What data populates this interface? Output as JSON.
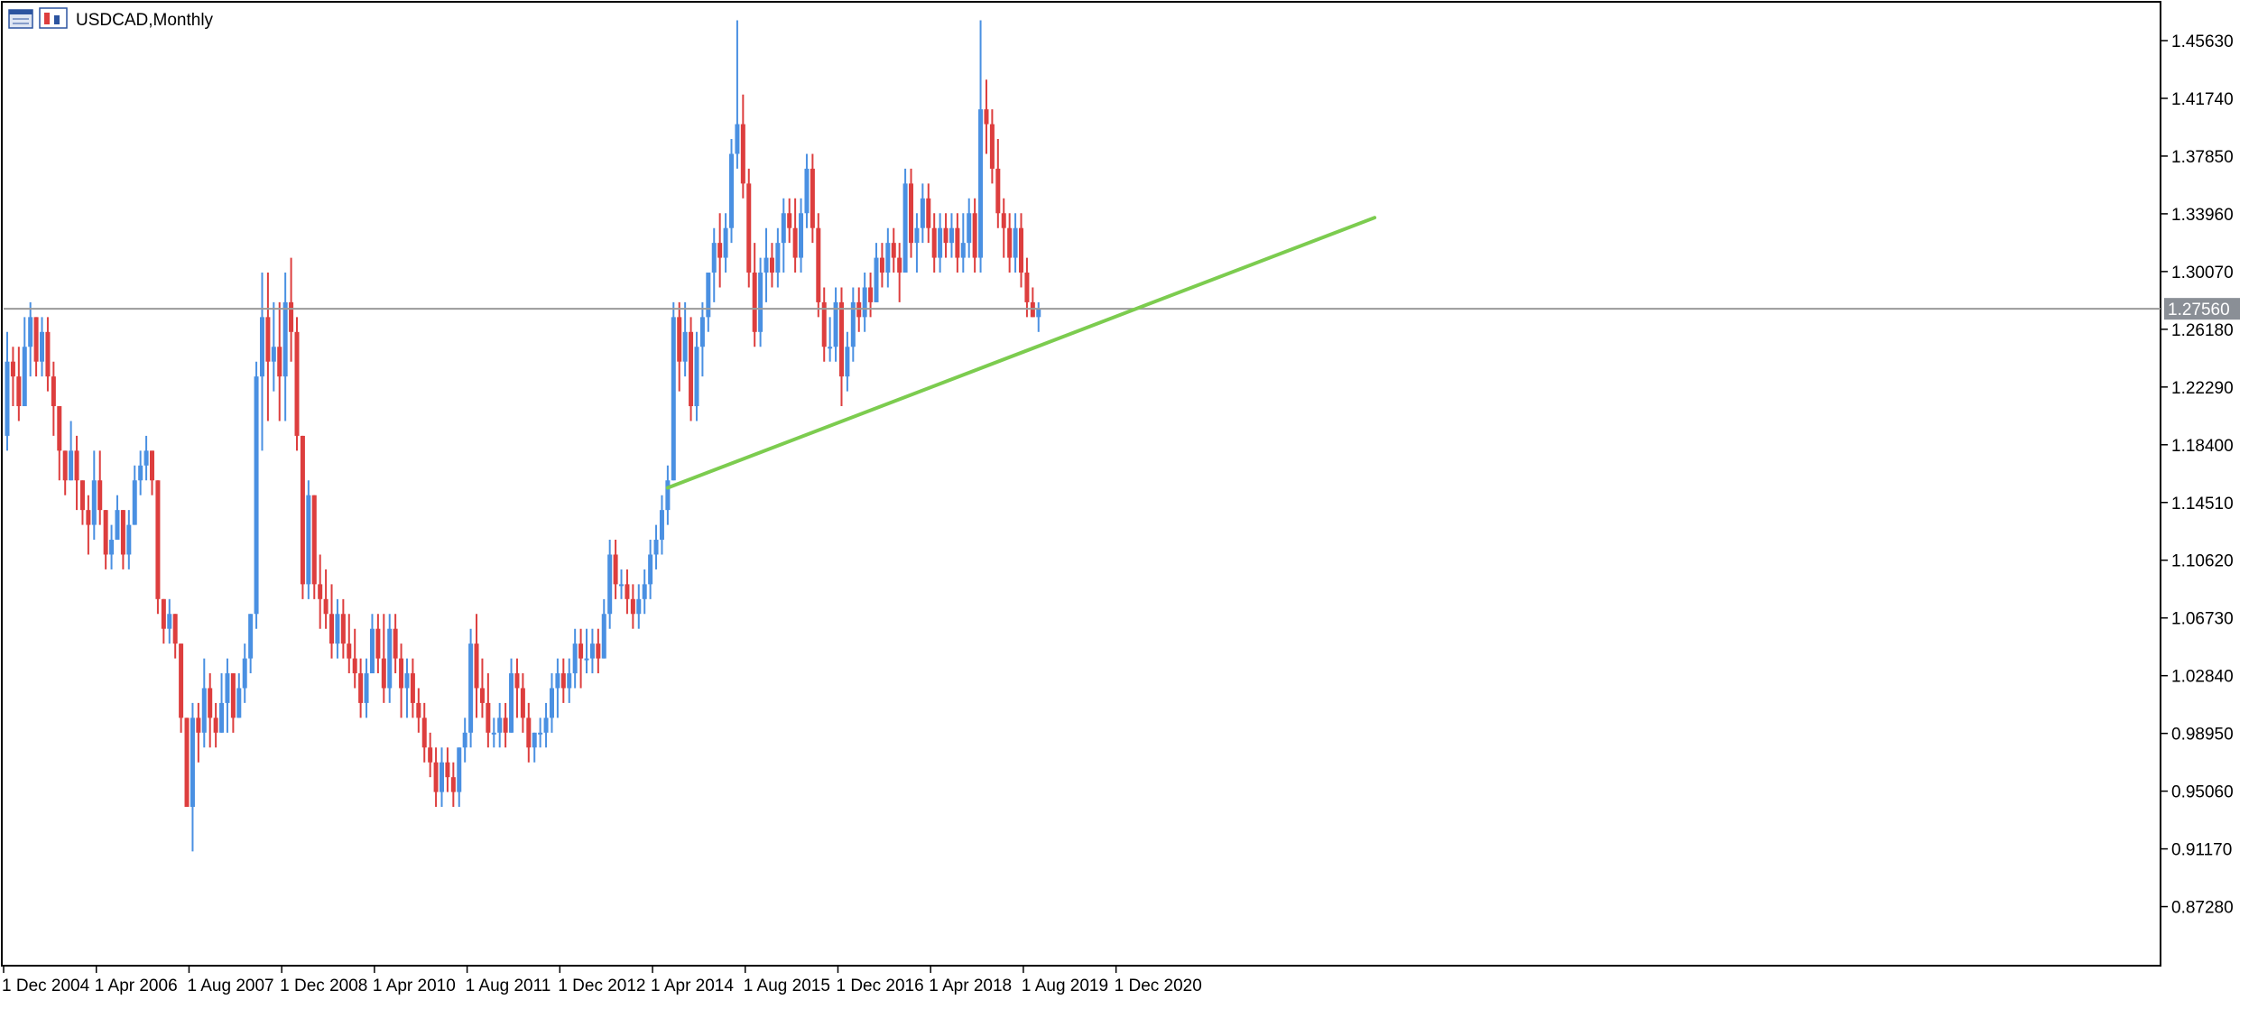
{
  "window": {
    "symbol_title": "USDCAD,Monthly",
    "icon": "chart-window-icon"
  },
  "colors": {
    "bull": "#4a90e2",
    "bear": "#dd3e3e",
    "trendline": "#7ccc4f",
    "price_line": "#9a9a9a",
    "price_tag_bg": "#8a8f96",
    "frame": "#000000"
  },
  "chart_data": {
    "type": "candlestick",
    "title": "USDCAD,Monthly",
    "xlabel": "",
    "ylabel": "",
    "ylim": [
      0.833,
      1.4715
    ],
    "y_ticks": [
      "1.45630",
      "1.41740",
      "1.37850",
      "1.33960",
      "1.30070",
      "1.26180",
      "1.22290",
      "1.18400",
      "1.14510",
      "1.10620",
      "1.06730",
      "1.02840",
      "0.98950",
      "0.95060",
      "0.91170",
      "0.87280"
    ],
    "x_tick_labels": [
      "1 Dec 2004",
      "1 Apr 2006",
      "1 Aug 2007",
      "1 Dec 2008",
      "1 Apr 2010",
      "1 Aug 2011",
      "1 Dec 2012",
      "1 Apr 2014",
      "1 Aug 2015",
      "1 Dec 2016",
      "1 Apr 2018",
      "1 Aug 2019",
      "1 Dec 2020"
    ],
    "x_tick_months": [
      0,
      16,
      32,
      48,
      64,
      80,
      96,
      112,
      128,
      144,
      160,
      176,
      192
    ],
    "current_price": "1.27560",
    "trendline": {
      "from": {
        "month": 114,
        "price": 1.155
      },
      "to": {
        "month": 236,
        "price": 1.337
      }
    },
    "grid": false,
    "ohlc": [
      [
        1.19,
        1.26,
        1.18,
        1.24
      ],
      [
        1.24,
        1.25,
        1.21,
        1.23
      ],
      [
        1.23,
        1.25,
        1.2,
        1.21
      ],
      [
        1.21,
        1.27,
        1.21,
        1.25
      ],
      [
        1.25,
        1.28,
        1.23,
        1.27
      ],
      [
        1.27,
        1.27,
        1.23,
        1.24
      ],
      [
        1.24,
        1.27,
        1.23,
        1.26
      ],
      [
        1.26,
        1.27,
        1.22,
        1.23
      ],
      [
        1.23,
        1.24,
        1.19,
        1.21
      ],
      [
        1.21,
        1.21,
        1.16,
        1.18
      ],
      [
        1.18,
        1.18,
        1.15,
        1.16
      ],
      [
        1.16,
        1.2,
        1.16,
        1.18
      ],
      [
        1.18,
        1.19,
        1.14,
        1.16
      ],
      [
        1.16,
        1.16,
        1.13,
        1.14
      ],
      [
        1.14,
        1.15,
        1.11,
        1.13
      ],
      [
        1.13,
        1.18,
        1.12,
        1.16
      ],
      [
        1.16,
        1.18,
        1.13,
        1.14
      ],
      [
        1.14,
        1.14,
        1.1,
        1.11
      ],
      [
        1.11,
        1.13,
        1.1,
        1.12
      ],
      [
        1.12,
        1.15,
        1.12,
        1.14
      ],
      [
        1.14,
        1.14,
        1.1,
        1.11
      ],
      [
        1.11,
        1.14,
        1.1,
        1.13
      ],
      [
        1.13,
        1.17,
        1.13,
        1.16
      ],
      [
        1.16,
        1.18,
        1.15,
        1.17
      ],
      [
        1.17,
        1.19,
        1.16,
        1.18
      ],
      [
        1.18,
        1.18,
        1.15,
        1.16
      ],
      [
        1.16,
        1.16,
        1.07,
        1.08
      ],
      [
        1.08,
        1.08,
        1.05,
        1.06
      ],
      [
        1.06,
        1.08,
        1.05,
        1.07
      ],
      [
        1.07,
        1.07,
        1.04,
        1.05
      ],
      [
        1.05,
        1.05,
        0.99,
        1.0
      ],
      [
        1.0,
        1.0,
        0.94,
        0.94
      ],
      [
        0.94,
        1.01,
        0.91,
        1.0
      ],
      [
        1.0,
        1.01,
        0.97,
        0.99
      ],
      [
        0.99,
        1.04,
        0.98,
        1.02
      ],
      [
        1.02,
        1.03,
        0.98,
        1.0
      ],
      [
        1.0,
        1.01,
        0.98,
        0.99
      ],
      [
        0.99,
        1.03,
        0.99,
        1.01
      ],
      [
        1.01,
        1.04,
        0.99,
        1.03
      ],
      [
        1.03,
        1.03,
        0.99,
        1.0
      ],
      [
        1.0,
        1.03,
        1.0,
        1.02
      ],
      [
        1.02,
        1.05,
        1.01,
        1.04
      ],
      [
        1.04,
        1.07,
        1.03,
        1.07
      ],
      [
        1.07,
        1.24,
        1.06,
        1.23
      ],
      [
        1.23,
        1.3,
        1.18,
        1.27
      ],
      [
        1.27,
        1.3,
        1.2,
        1.24
      ],
      [
        1.24,
        1.28,
        1.22,
        1.25
      ],
      [
        1.25,
        1.28,
        1.2,
        1.23
      ],
      [
        1.23,
        1.3,
        1.2,
        1.28
      ],
      [
        1.28,
        1.31,
        1.24,
        1.26
      ],
      [
        1.26,
        1.27,
        1.18,
        1.19
      ],
      [
        1.19,
        1.19,
        1.08,
        1.09
      ],
      [
        1.09,
        1.16,
        1.08,
        1.15
      ],
      [
        1.15,
        1.15,
        1.08,
        1.09
      ],
      [
        1.09,
        1.11,
        1.06,
        1.08
      ],
      [
        1.08,
        1.1,
        1.06,
        1.07
      ],
      [
        1.07,
        1.09,
        1.04,
        1.05
      ],
      [
        1.05,
        1.08,
        1.04,
        1.07
      ],
      [
        1.07,
        1.08,
        1.04,
        1.05
      ],
      [
        1.05,
        1.07,
        1.03,
        1.04
      ],
      [
        1.04,
        1.06,
        1.02,
        1.03
      ],
      [
        1.03,
        1.04,
        1.0,
        1.01
      ],
      [
        1.01,
        1.04,
        1.0,
        1.03
      ],
      [
        1.03,
        1.07,
        1.03,
        1.06
      ],
      [
        1.06,
        1.07,
        1.03,
        1.04
      ],
      [
        1.04,
        1.07,
        1.01,
        1.02
      ],
      [
        1.02,
        1.07,
        1.01,
        1.06
      ],
      [
        1.06,
        1.07,
        1.03,
        1.04
      ],
      [
        1.04,
        1.05,
        1.0,
        1.02
      ],
      [
        1.02,
        1.04,
        1.0,
        1.03
      ],
      [
        1.03,
        1.04,
        1.0,
        1.01
      ],
      [
        1.01,
        1.02,
        0.99,
        1.0
      ],
      [
        1.0,
        1.01,
        0.97,
        0.98
      ],
      [
        0.98,
        0.99,
        0.96,
        0.97
      ],
      [
        0.97,
        0.98,
        0.94,
        0.95
      ],
      [
        0.95,
        0.98,
        0.94,
        0.97
      ],
      [
        0.97,
        0.98,
        0.95,
        0.96
      ],
      [
        0.96,
        0.97,
        0.94,
        0.95
      ],
      [
        0.95,
        0.98,
        0.94,
        0.98
      ],
      [
        0.98,
        1.0,
        0.97,
        0.99
      ],
      [
        0.99,
        1.06,
        0.98,
        1.05
      ],
      [
        1.05,
        1.07,
        1.0,
        1.02
      ],
      [
        1.02,
        1.04,
        1.0,
        1.01
      ],
      [
        1.01,
        1.03,
        0.98,
        0.99
      ],
      [
        0.99,
        1.0,
        0.98,
        0.99
      ],
      [
        0.99,
        1.01,
        0.98,
        1.0
      ],
      [
        1.0,
        1.01,
        0.98,
        0.99
      ],
      [
        0.99,
        1.04,
        0.99,
        1.03
      ],
      [
        1.03,
        1.04,
        1.0,
        1.02
      ],
      [
        1.02,
        1.03,
        0.99,
        1.0
      ],
      [
        1.0,
        1.01,
        0.97,
        0.98
      ],
      [
        0.98,
        0.99,
        0.97,
        0.99
      ],
      [
        0.99,
        1.0,
        0.98,
        0.99
      ],
      [
        0.99,
        1.01,
        0.98,
        1.0
      ],
      [
        1.0,
        1.03,
        0.99,
        1.02
      ],
      [
        1.02,
        1.04,
        1.0,
        1.03
      ],
      [
        1.03,
        1.04,
        1.01,
        1.02
      ],
      [
        1.02,
        1.04,
        1.01,
        1.03
      ],
      [
        1.03,
        1.06,
        1.02,
        1.05
      ],
      [
        1.05,
        1.06,
        1.02,
        1.04
      ],
      [
        1.04,
        1.06,
        1.03,
        1.04
      ],
      [
        1.04,
        1.06,
        1.03,
        1.05
      ],
      [
        1.05,
        1.06,
        1.03,
        1.04
      ],
      [
        1.04,
        1.08,
        1.04,
        1.07
      ],
      [
        1.07,
        1.12,
        1.06,
        1.11
      ],
      [
        1.11,
        1.12,
        1.08,
        1.09
      ],
      [
        1.09,
        1.1,
        1.08,
        1.09
      ],
      [
        1.09,
        1.1,
        1.07,
        1.08
      ],
      [
        1.08,
        1.09,
        1.06,
        1.07
      ],
      [
        1.07,
        1.09,
        1.06,
        1.08
      ],
      [
        1.08,
        1.1,
        1.07,
        1.09
      ],
      [
        1.09,
        1.12,
        1.08,
        1.11
      ],
      [
        1.11,
        1.13,
        1.1,
        1.12
      ],
      [
        1.12,
        1.15,
        1.11,
        1.14
      ],
      [
        1.14,
        1.17,
        1.13,
        1.16
      ],
      [
        1.16,
        1.28,
        1.16,
        1.27
      ],
      [
        1.27,
        1.28,
        1.22,
        1.24
      ],
      [
        1.24,
        1.28,
        1.23,
        1.26
      ],
      [
        1.26,
        1.27,
        1.2,
        1.21
      ],
      [
        1.21,
        1.26,
        1.2,
        1.25
      ],
      [
        1.25,
        1.28,
        1.23,
        1.27
      ],
      [
        1.27,
        1.3,
        1.26,
        1.3
      ],
      [
        1.3,
        1.33,
        1.28,
        1.32
      ],
      [
        1.32,
        1.34,
        1.29,
        1.31
      ],
      [
        1.31,
        1.34,
        1.3,
        1.33
      ],
      [
        1.33,
        1.39,
        1.32,
        1.38
      ],
      [
        1.38,
        1.47,
        1.37,
        1.4
      ],
      [
        1.4,
        1.42,
        1.35,
        1.36
      ],
      [
        1.36,
        1.37,
        1.29,
        1.3
      ],
      [
        1.3,
        1.32,
        1.25,
        1.26
      ],
      [
        1.26,
        1.31,
        1.25,
        1.3
      ],
      [
        1.3,
        1.33,
        1.28,
        1.31
      ],
      [
        1.31,
        1.32,
        1.29,
        1.3
      ],
      [
        1.3,
        1.33,
        1.29,
        1.32
      ],
      [
        1.32,
        1.35,
        1.3,
        1.34
      ],
      [
        1.34,
        1.35,
        1.32,
        1.33
      ],
      [
        1.33,
        1.35,
        1.3,
        1.31
      ],
      [
        1.31,
        1.35,
        1.3,
        1.34
      ],
      [
        1.34,
        1.38,
        1.33,
        1.37
      ],
      [
        1.37,
        1.38,
        1.32,
        1.33
      ],
      [
        1.33,
        1.34,
        1.27,
        1.28
      ],
      [
        1.28,
        1.29,
        1.24,
        1.25
      ],
      [
        1.25,
        1.27,
        1.24,
        1.25
      ],
      [
        1.25,
        1.29,
        1.24,
        1.28
      ],
      [
        1.28,
        1.29,
        1.21,
        1.23
      ],
      [
        1.23,
        1.26,
        1.22,
        1.25
      ],
      [
        1.25,
        1.29,
        1.24,
        1.28
      ],
      [
        1.28,
        1.29,
        1.26,
        1.27
      ],
      [
        1.27,
        1.3,
        1.26,
        1.29
      ],
      [
        1.29,
        1.3,
        1.27,
        1.28
      ],
      [
        1.28,
        1.32,
        1.28,
        1.31
      ],
      [
        1.31,
        1.32,
        1.29,
        1.3
      ],
      [
        1.3,
        1.33,
        1.29,
        1.32
      ],
      [
        1.32,
        1.33,
        1.3,
        1.31
      ],
      [
        1.31,
        1.32,
        1.28,
        1.3
      ],
      [
        1.3,
        1.37,
        1.3,
        1.36
      ],
      [
        1.36,
        1.37,
        1.31,
        1.32
      ],
      [
        1.32,
        1.34,
        1.3,
        1.33
      ],
      [
        1.33,
        1.36,
        1.32,
        1.35
      ],
      [
        1.35,
        1.36,
        1.32,
        1.33
      ],
      [
        1.33,
        1.34,
        1.3,
        1.31
      ],
      [
        1.31,
        1.34,
        1.3,
        1.33
      ],
      [
        1.33,
        1.34,
        1.31,
        1.32
      ],
      [
        1.32,
        1.34,
        1.31,
        1.33
      ],
      [
        1.33,
        1.34,
        1.3,
        1.31
      ],
      [
        1.31,
        1.34,
        1.3,
        1.32
      ],
      [
        1.32,
        1.35,
        1.31,
        1.34
      ],
      [
        1.34,
        1.35,
        1.3,
        1.31
      ],
      [
        1.31,
        1.47,
        1.3,
        1.41
      ],
      [
        1.41,
        1.43,
        1.38,
        1.4
      ],
      [
        1.4,
        1.41,
        1.36,
        1.37
      ],
      [
        1.37,
        1.39,
        1.33,
        1.34
      ],
      [
        1.34,
        1.35,
        1.31,
        1.33
      ],
      [
        1.33,
        1.34,
        1.3,
        1.31
      ],
      [
        1.31,
        1.34,
        1.3,
        1.33
      ],
      [
        1.33,
        1.34,
        1.29,
        1.3
      ],
      [
        1.3,
        1.31,
        1.27,
        1.28
      ],
      [
        1.28,
        1.29,
        1.27,
        1.27
      ],
      [
        1.27,
        1.28,
        1.26,
        1.276
      ]
    ]
  }
}
